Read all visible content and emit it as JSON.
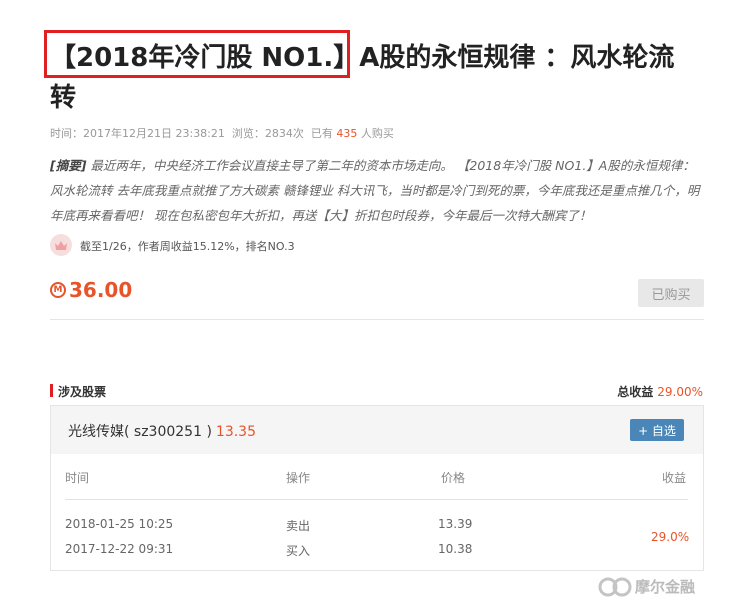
{
  "article": {
    "title_highlight": "【2018年冷门股 NO1.】",
    "title_rest": "A股的永恒规律 ：风水轮流转",
    "meta_time_label": "时间：",
    "meta_time": "2017年12月21日 23:38:21",
    "meta_views_label": "浏览：",
    "meta_views": "2834次",
    "meta_buyers_prefix": "已有",
    "meta_buyers": "435",
    "meta_buyers_suffix": "人购买",
    "summary_tag": "[摘要]",
    "summary_text": "最近两年，中央经济工作会议直接主导了第二年的资本市场走向。 【2018年冷门股 NO1.】A股的永恒规律：风水轮流转 去年底我重点就推了方大碳素 赣锋锂业 科大讯飞，当时都是冷门到死的票，今年底我还是重点推几个，明年底再来看看吧！ 现在包私密包年大折扣，再送【大】折扣包时段券，今年最后一次特大酬宾了！",
    "stats_text": "截至1/26，作者周收益15.12%，排名NO.3",
    "price": "36.00",
    "bought_label": "已购买"
  },
  "stocks_section": {
    "title": "涉及股票",
    "total_return_label": "总收益",
    "total_return_value": "29.00%"
  },
  "stock": {
    "name": "光线传媒( sz300251 )",
    "price": "13.35",
    "add_button": "+ 自选",
    "headers": [
      "时间",
      "操作",
      "价格",
      "收益"
    ],
    "rows": [
      {
        "time": "2018-01-25 10:25",
        "action": "卖出",
        "price": "13.39"
      },
      {
        "time": "2017-12-22 09:31",
        "action": "买入",
        "price": "10.38"
      }
    ],
    "return": "29.0%"
  },
  "watermark": {
    "text": "摩尔金融"
  },
  "colors": {
    "accent": "#e8542a",
    "highlight_box": "#e02020",
    "add_button": "#4a86b8"
  },
  "icons": [
    "crown-icon",
    "currency-icon",
    "watermark-logo-icon"
  ]
}
